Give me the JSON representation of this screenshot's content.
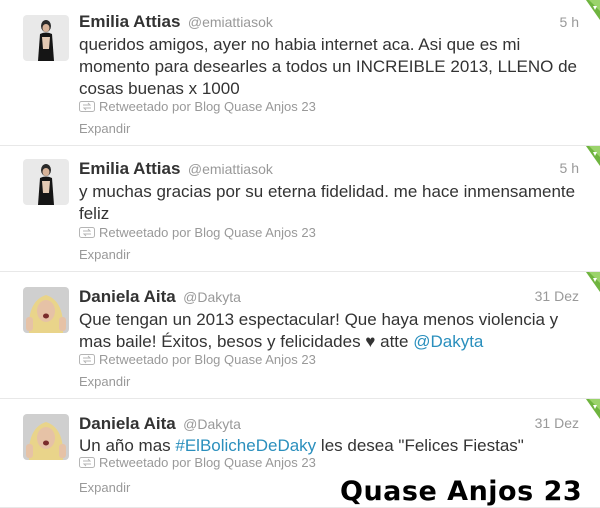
{
  "tweets": [
    {
      "name": "Emilia Attias",
      "handle": "@emiattiasok",
      "time": "5 h",
      "text": "queridos amigos, ayer no habia internet aca. Asi que es mi momento para desearles a todos un INCREIBLE 2013, LLENO de cosas buenas x 1000",
      "retweeted_by": "Retweetado por Blog Quase Anjos 23",
      "expand": "Expandir"
    },
    {
      "name": "Emilia Attias",
      "handle": "@emiattiasok",
      "time": "5 h",
      "text": "y muchas gracias por su eterna fidelidad. me hace inmensamente feliz",
      "retweeted_by": "Retweetado por Blog Quase Anjos 23",
      "expand": "Expandir"
    },
    {
      "name": "Daniela Aita",
      "handle": "@Dakyta",
      "time": "31 Dez",
      "text_before": "Que tengan un 2013 espectacular! Que haya menos violencia y mas baile! Éxitos, besos y felicidades ♥ atte ",
      "mention": "@Dakyta",
      "retweeted_by": "Retweetado por Blog Quase Anjos 23",
      "expand": "Expandir"
    },
    {
      "name": "Daniela Aita",
      "handle": "@Dakyta",
      "time": "31 Dez",
      "text_before": "Un año mas ",
      "hashtag": "#ElBolicheDeDaky",
      "text_after": " les desea \"Felices Fiestas\"",
      "retweeted_by": "Retweetado por Blog Quase Anjos 23",
      "expand": "Expandir"
    }
  ],
  "watermark": "Quase Anjos 23",
  "colors": {
    "link": "#2a8fbd",
    "muted": "#999999",
    "text": "#333333",
    "corner_green": "#6fb43f"
  },
  "icons": {
    "retweet": "retweet-icon",
    "corner": "tweet-corner-fold-icon"
  }
}
